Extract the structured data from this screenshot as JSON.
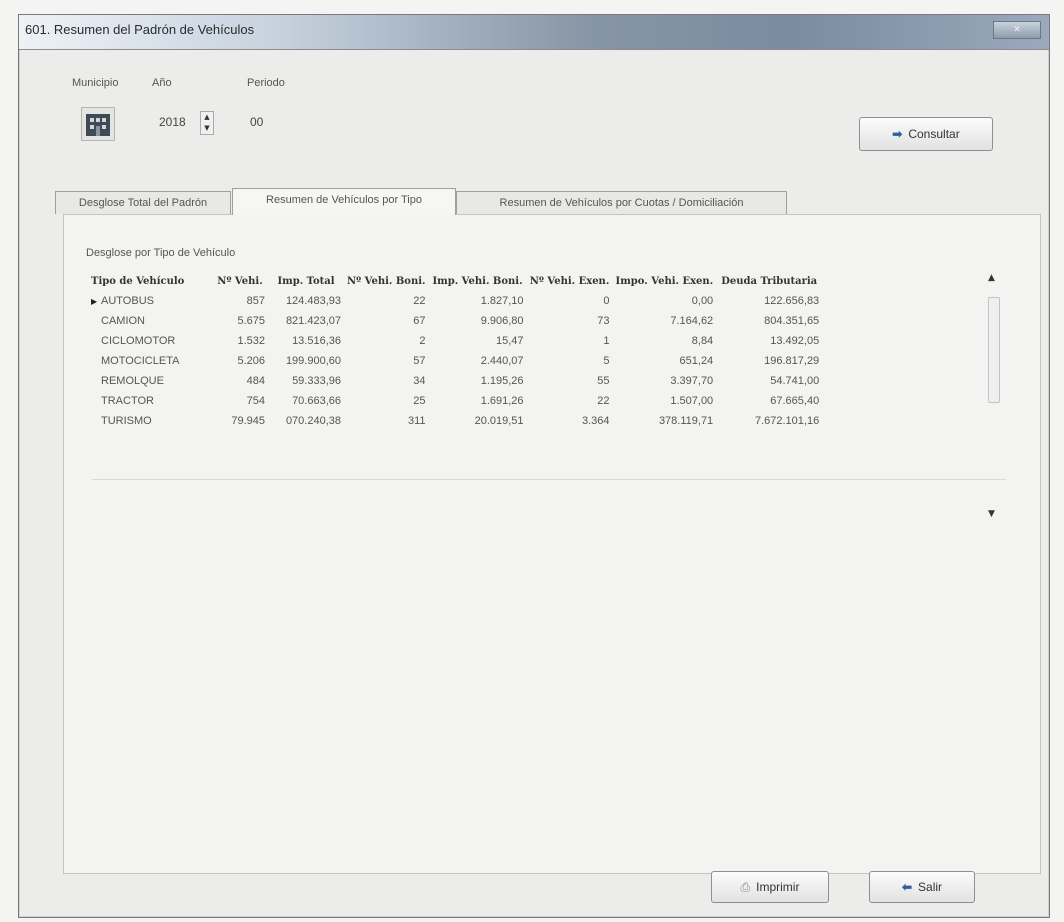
{
  "window": {
    "title": "601. Resumen del Padrón de Vehículos"
  },
  "filters": {
    "municipio_label": "Municipio",
    "anio_label": "Año",
    "anio_value": "2018",
    "periodo_label": "Periodo",
    "periodo_value": "00"
  },
  "consultar_label": "Consultar",
  "tabs": [
    {
      "label": "Desglose Total del Padrón"
    },
    {
      "label": "Resumen de Vehículos por Tipo"
    },
    {
      "label": "Resumen de Vehículos por Cuotas / Domiciliación"
    }
  ],
  "group_title": "Desglose por Tipo de Vehículo",
  "table": {
    "columns": [
      "Tipo de Vehículo",
      "Nº Vehi.",
      "Imp. Total",
      "Nº Vehi. Boni.",
      "Imp. Vehi. Boni.",
      "Nº Vehi. Exen.",
      "Impo. Vehi. Exen.",
      "Deuda Tributaria"
    ],
    "rows": [
      [
        "AUTOBUS",
        "857",
        "124.483,93",
        "22",
        "1.827,10",
        "0",
        "0,00",
        "122.656,83"
      ],
      [
        "CAMION",
        "5.675",
        "821.423,07",
        "67",
        "9.906,80",
        "73",
        "7.164,62",
        "804.351,65"
      ],
      [
        "CICLOMOTOR",
        "1.532",
        "13.516,36",
        "2",
        "15,47",
        "1",
        "8,84",
        "13.492,05"
      ],
      [
        "MOTOCICLETA",
        "5.206",
        "199.900,60",
        "57",
        "2.440,07",
        "5",
        "651,24",
        "196.817,29"
      ],
      [
        "REMOLQUE",
        "484",
        "59.333,96",
        "34",
        "1.195,26",
        "55",
        "3.397,70",
        "54.741,00"
      ],
      [
        "TRACTOR",
        "754",
        "70.663,66",
        "25",
        "1.691,26",
        "22",
        "1.507,00",
        "67.665,40"
      ],
      [
        "TURISMO",
        "79.945",
        "070.240,38",
        "311",
        "20.019,51",
        "3.364",
        "378.119,71",
        "7.672.101,16"
      ]
    ]
  },
  "buttons": {
    "imprimir_label": "Imprimir",
    "salir_label": "Salir"
  }
}
